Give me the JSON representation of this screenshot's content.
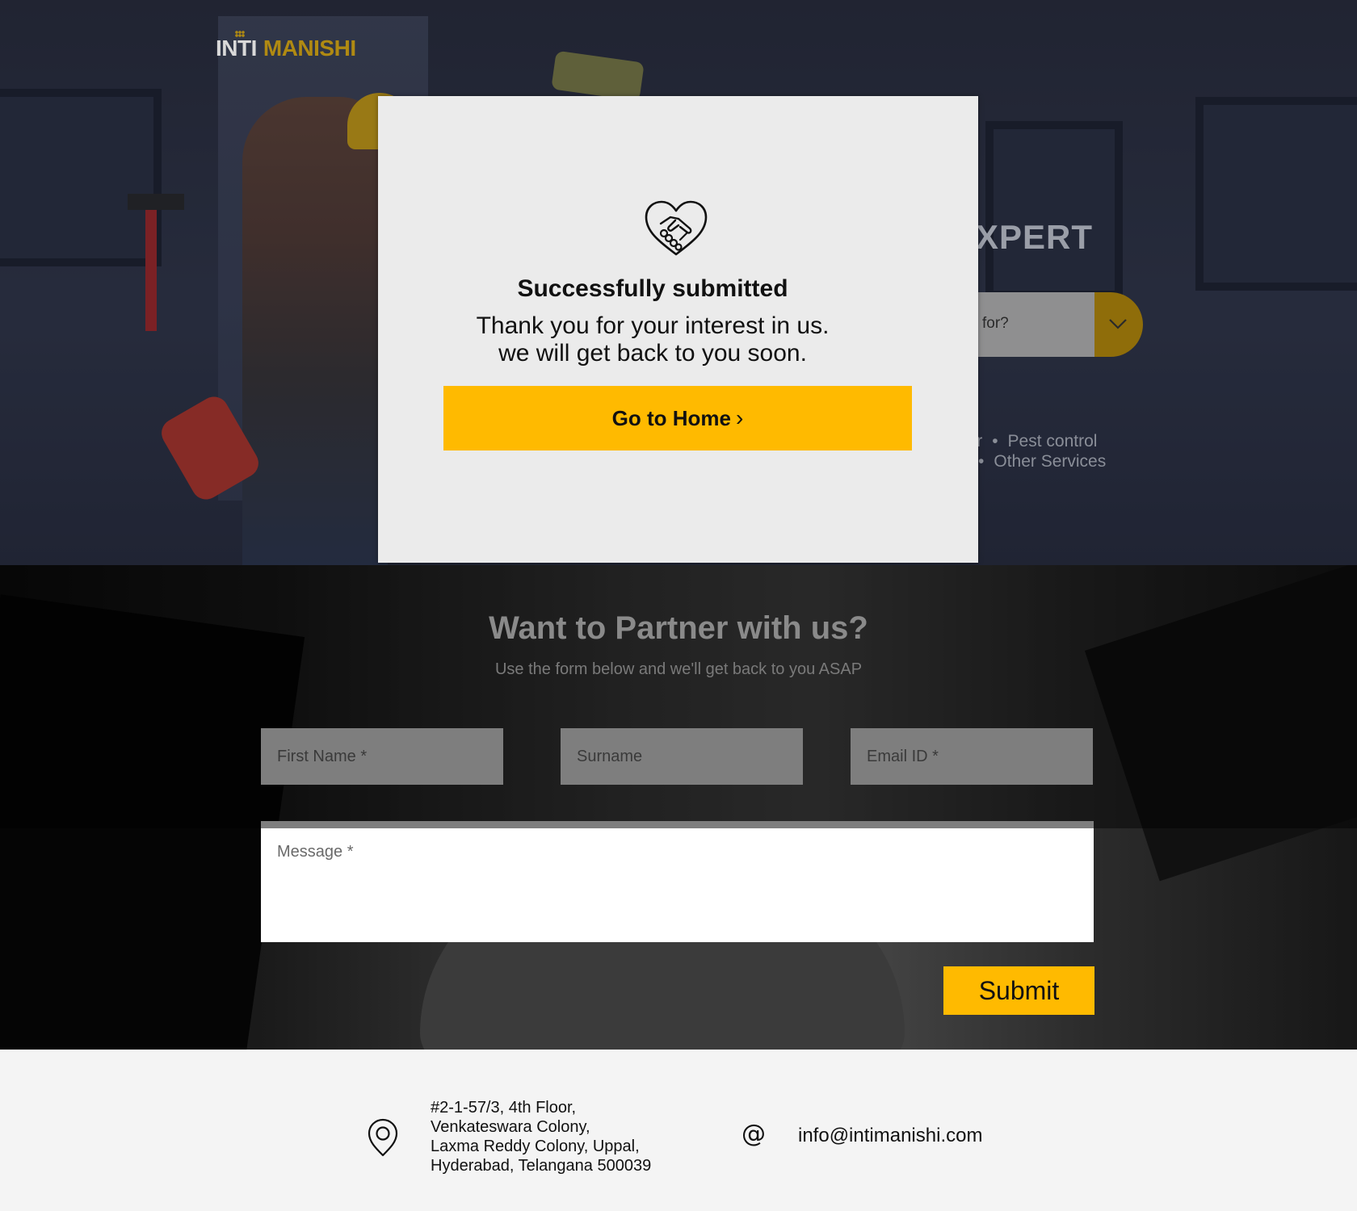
{
  "brand": {
    "logo_part1": "INTI",
    "logo_part2": "MANISHI",
    "accent_color": "#ffba00"
  },
  "hero": {
    "heading_visible": "XPERT",
    "search_placeholder_visible": "for?",
    "search_button_icon": "chevron-down-icon",
    "services_row1": [
      "ntor",
      "Pest control"
    ],
    "services_row2": [
      "Other Services"
    ]
  },
  "modal": {
    "icon": "handshake-heart-icon",
    "title": "Successfully submitted",
    "message_line1": "Thank you for your interest in us.",
    "message_line2": "we will get back to you soon.",
    "button_label": "Go to Home",
    "button_chevron": "›"
  },
  "partner": {
    "title": "Want to Partner with us?",
    "subtitle": "Use the form below and we'll get back to you ASAP",
    "fields": {
      "first_name_placeholder": "First Name *",
      "surname_placeholder": "Surname",
      "email_placeholder": "Email ID *",
      "message_placeholder": "Message *"
    },
    "submit_label": "Submit"
  },
  "footer": {
    "address_lines": [
      "#2-1-57/3, 4th Floor,",
      "Venkateswara Colony,",
      "Laxma Reddy Colony, Uppal,",
      "Hyderabad, Telangana 500039"
    ],
    "email_symbol": "@",
    "email": "info@intimanishi.com"
  }
}
